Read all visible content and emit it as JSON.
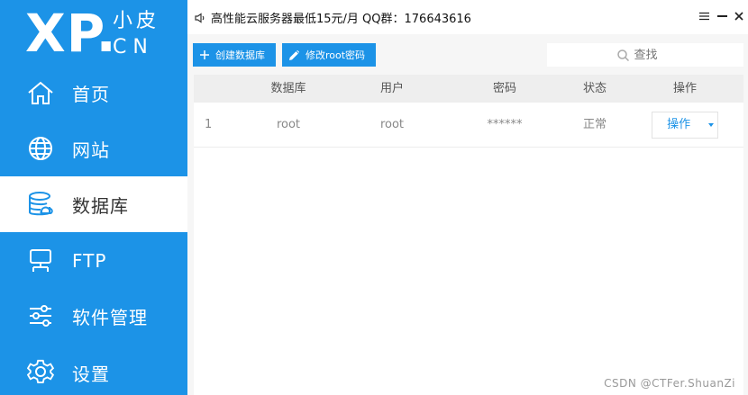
{
  "brand": {
    "big": "XP.",
    "small_top": "小皮",
    "small_bottom": "CN"
  },
  "sidebar": {
    "items": [
      {
        "label": "首页",
        "icon": "home-icon",
        "active": false
      },
      {
        "label": "网站",
        "icon": "globe-icon",
        "active": false
      },
      {
        "label": "数据库",
        "icon": "database-icon",
        "active": true
      },
      {
        "label": "FTP",
        "icon": "monitor-icon",
        "active": false
      },
      {
        "label": "软件管理",
        "icon": "sliders-icon",
        "active": false
      },
      {
        "label": "设置",
        "icon": "gear-icon",
        "active": false
      }
    ]
  },
  "topbar": {
    "notice": "高性能云服务器最低15元/月  QQ群：176643616",
    "notice_icon": "speaker-icon",
    "controls": [
      "menu-icon",
      "minimize-icon",
      "close-icon"
    ]
  },
  "toolbar": {
    "create_db_label": "创建数据库",
    "edit_root_label": "修改root密码",
    "search_placeholder": "查找"
  },
  "table": {
    "headers": [
      "数据库",
      "用户",
      "密码",
      "状态",
      "操作"
    ],
    "rows": [
      {
        "index": "1",
        "database": "root",
        "user": "root",
        "password": "******",
        "status": "正常",
        "action": "操作"
      }
    ]
  },
  "watermark": "CSDN @CTFer.ShuanZi",
  "colors": {
    "accent": "#1c93e7",
    "header_bg": "#eeeeee",
    "content_bg": "#f6f6f6"
  }
}
